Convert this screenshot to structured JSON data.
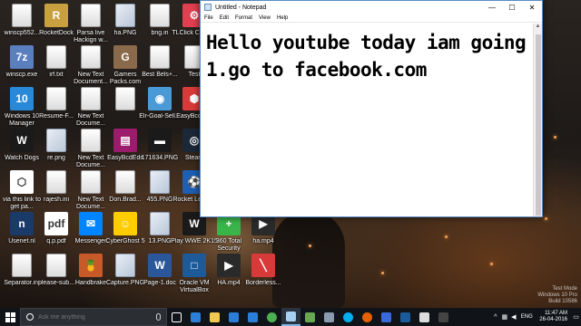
{
  "desktop": {
    "icons": [
      {
        "label": "winscp552...",
        "kind": "doc",
        "color": "#ffffff"
      },
      {
        "label": "RocketDock",
        "kind": "app",
        "color": "#c8a040",
        "glyph": "R"
      },
      {
        "label": "Parsa live Hackign w...",
        "kind": "doc",
        "color": "#ffffff"
      },
      {
        "label": "ha.PNG",
        "kind": "img",
        "color": "#ffffff"
      },
      {
        "label": "bng.in",
        "kind": "doc",
        "color": "#ffffff"
      },
      {
        "label": "TLClick Colepai",
        "kind": "app",
        "color": "#e04050",
        "glyph": "⚙"
      },
      {
        "label": "gernyne",
        "kind": "app",
        "color": "#3a7bd5",
        "glyph": "G"
      },
      {
        "label": "winscp.exe",
        "kind": "app",
        "color": "#5a7fbf",
        "glyph": "7z"
      },
      {
        "label": "irf.txt",
        "kind": "doc",
        "color": "#ffffff"
      },
      {
        "label": "New Text Document...",
        "kind": "doc",
        "color": "#ffffff"
      },
      {
        "label": "Gamers Packs.com",
        "kind": "app",
        "color": "#8a6a4a",
        "glyph": "G"
      },
      {
        "label": "Best Bels+...",
        "kind": "doc",
        "color": "#ffffff"
      },
      {
        "label": "Test",
        "kind": "doc",
        "color": "#ffffff"
      },
      {
        "label": "Windows 10 Manager",
        "kind": "app",
        "color": "#2a88d8",
        "glyph": "10"
      },
      {
        "label": "Resume-F...",
        "kind": "doc",
        "color": "#ffffff"
      },
      {
        "label": "New Text Docume...",
        "kind": "doc",
        "color": "#ffffff"
      },
      {
        "label": "",
        "kind": "doc",
        "color": "#ffffff"
      },
      {
        "label": "Elr-Goal-Sell...",
        "kind": "app",
        "color": "#4a9ad8",
        "glyph": "◉"
      },
      {
        "label": "EasyBcdEdit",
        "kind": "app",
        "color": "#d83a3a",
        "glyph": "⬢"
      },
      {
        "label": "Watch Dogs",
        "kind": "app",
        "color": "#1a1a1a",
        "glyph": "W"
      },
      {
        "label": "re.png",
        "kind": "img",
        "color": "#ffffff"
      },
      {
        "label": "New Text Docume...",
        "kind": "doc",
        "color": "#ffffff"
      },
      {
        "label": "EasyBcdEdit",
        "kind": "app",
        "color": "#9b1b6d",
        "glyph": "▤"
      },
      {
        "label": "171634.PNG",
        "kind": "app",
        "color": "#1a1a1a",
        "glyph": "▬"
      },
      {
        "label": "Steam",
        "kind": "app",
        "color": "#1b2838",
        "glyph": "◎"
      },
      {
        "label": "via this link to get pa...",
        "kind": "app",
        "color": "#ffffff",
        "glyph": "⬡"
      },
      {
        "label": "rajesh.ini",
        "kind": "doc",
        "color": "#ffffff"
      },
      {
        "label": "New Text Docume...",
        "kind": "doc",
        "color": "#ffffff"
      },
      {
        "label": "Don.Brad...",
        "kind": "doc",
        "color": "#ffffff"
      },
      {
        "label": "455.PNG",
        "kind": "img",
        "color": "#ffffff"
      },
      {
        "label": "Rocket League",
        "kind": "app",
        "color": "#1e5fb4",
        "glyph": "⚽"
      },
      {
        "label": "Usenet.nl",
        "kind": "app",
        "color": "#1a3a6a",
        "glyph": "n"
      },
      {
        "label": "q.p.pdf",
        "kind": "app",
        "color": "#ffffff",
        "glyph": "pdf"
      },
      {
        "label": "Messenger",
        "kind": "app",
        "color": "#0084ff",
        "glyph": "✉"
      },
      {
        "label": "CyberGhost 5",
        "kind": "app",
        "color": "#ffcc00",
        "glyph": "☺"
      },
      {
        "label": "13.PNG",
        "kind": "img",
        "color": "#ffffff"
      },
      {
        "label": "Play WWE 2K15",
        "kind": "app",
        "color": "#1a1a1a",
        "glyph": "W"
      },
      {
        "label": "360 Total Security",
        "kind": "app",
        "color": "#3ab54a",
        "glyph": "+"
      },
      {
        "label": "ha.mp4",
        "kind": "app",
        "color": "#2a2a2a",
        "glyph": "▶"
      },
      {
        "label": "Separator.ini",
        "kind": "doc",
        "color": "#ffffff"
      },
      {
        "label": "please-sub...",
        "kind": "doc",
        "color": "#ffffff"
      },
      {
        "label": "Handbrake",
        "kind": "app",
        "color": "#c85a2a",
        "glyph": "🍍"
      },
      {
        "label": "Capture.PNG",
        "kind": "img",
        "color": "#ffffff"
      },
      {
        "label": "Page-1.doc",
        "kind": "app",
        "color": "#2b579a",
        "glyph": "W"
      },
      {
        "label": "Oracle VM VirtualBox",
        "kind": "app",
        "color": "#1c5a9a",
        "glyph": "□"
      },
      {
        "label": "HA.mp4",
        "kind": "app",
        "color": "#2a2a2a",
        "glyph": "▶"
      },
      {
        "label": "Borderless...",
        "kind": "app",
        "color": "#d83a3a",
        "glyph": "╲"
      }
    ]
  },
  "notepad": {
    "title": "Untitled - Notepad",
    "menu": [
      "File",
      "Edit",
      "Format",
      "View",
      "Help"
    ],
    "lines": [
      "Hello youtube today iam going t",
      "1.go to facebook.com"
    ],
    "minimize": "—",
    "maximize": "☐",
    "close": "✕"
  },
  "taskbar": {
    "search_placeholder": "Ask me anything",
    "apps": [
      {
        "name": "task-view",
        "color": "#ffffff"
      },
      {
        "name": "edge",
        "color": "#2b7fd8"
      },
      {
        "name": "file-explorer",
        "color": "#f2c94c"
      },
      {
        "name": "store",
        "color": "#2b7fd8"
      },
      {
        "name": "mail",
        "color": "#2b7fd8"
      },
      {
        "name": "chrome",
        "color": "#4caf50"
      },
      {
        "name": "notepad",
        "color": "#a8d0f0"
      },
      {
        "name": "minecraft",
        "color": "#6aa84f"
      },
      {
        "name": "steam",
        "color": "#8a9ab0"
      },
      {
        "name": "skype",
        "color": "#00aff0"
      },
      {
        "name": "firefox",
        "color": "#e66000"
      },
      {
        "name": "app-blue",
        "color": "#3a6ad8"
      },
      {
        "name": "virtualbox",
        "color": "#1c5a9a"
      },
      {
        "name": "app-sq",
        "color": "#dddddd"
      },
      {
        "name": "app-dark",
        "color": "#444444"
      }
    ],
    "active_app": "notepad",
    "language": "ENG",
    "time": "11:47 AM",
    "date": "26-04-2016"
  },
  "watermark": {
    "line1": "Test Mode",
    "line2": "Windows 10 Pro",
    "line3": "Build 10586"
  }
}
